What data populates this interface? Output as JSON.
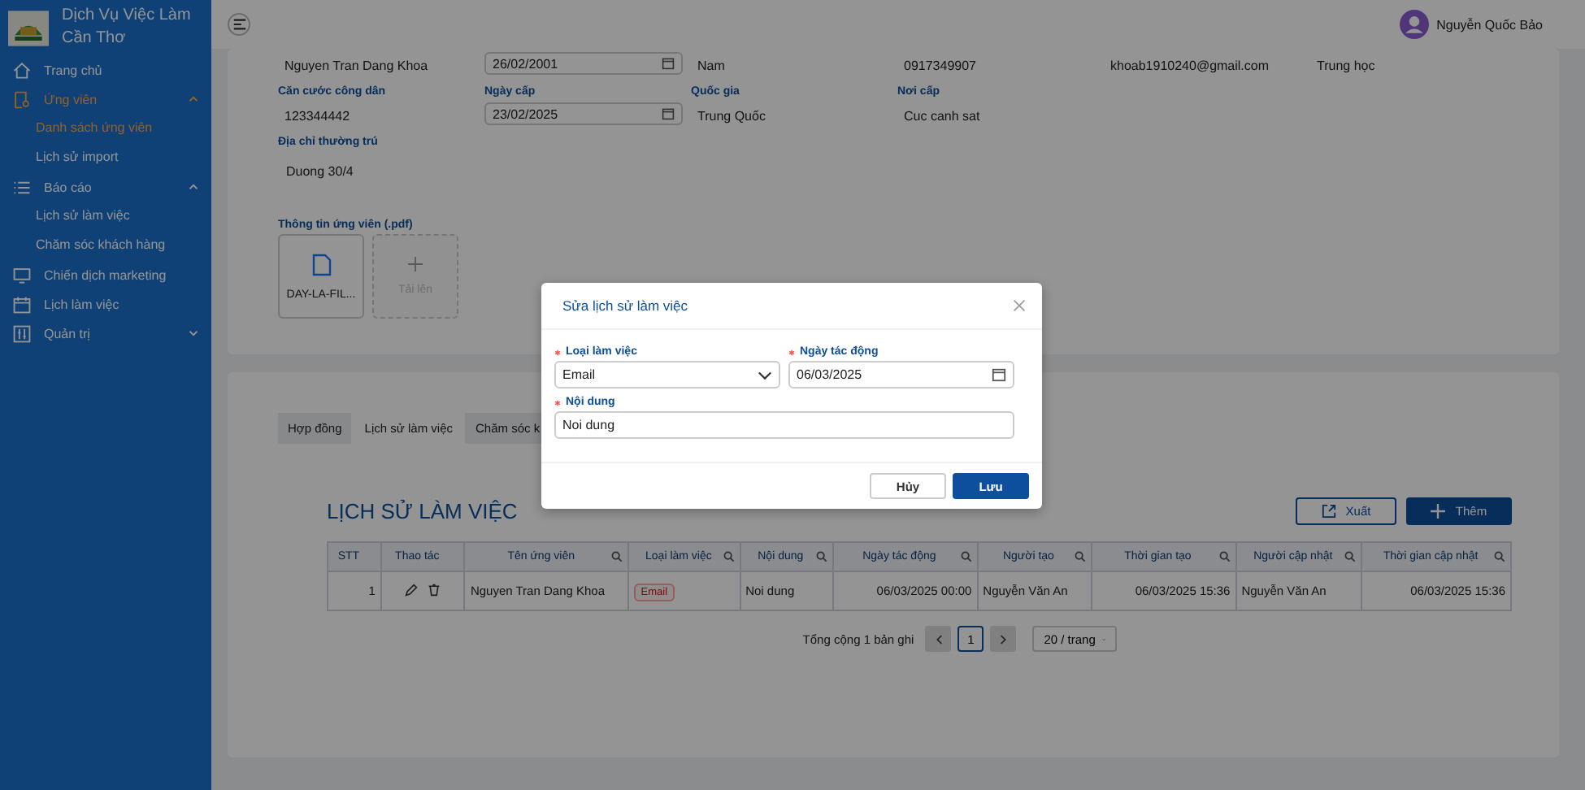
{
  "sidebar": {
    "brand": "Dịch Vụ Việc Làm Cần Thơ",
    "items": [
      {
        "label": "Trang chủ",
        "selected": false
      },
      {
        "label": "Ứng viên",
        "selected": true,
        "expanded": true,
        "children": [
          {
            "label": "Danh sách ứng viên",
            "selected": true
          },
          {
            "label": "Lịch sử import",
            "selected": false
          }
        ]
      },
      {
        "label": "Báo cáo",
        "selected": false,
        "expanded": true,
        "children": [
          {
            "label": "Lịch sử làm việc",
            "selected": false
          },
          {
            "label": "Chăm sóc khách hàng",
            "selected": false
          }
        ]
      },
      {
        "label": "Chiến dịch marketing",
        "selected": false
      },
      {
        "label": "Lịch làm việc",
        "selected": false
      },
      {
        "label": "Quản trị",
        "selected": false,
        "expanded": false
      }
    ]
  },
  "header": {
    "user": "Nguyễn Quốc Bảo"
  },
  "profile": {
    "rows": [
      [
        {
          "value": "Nguyen Tran Dang Khoa",
          "kind": "text"
        },
        {
          "value": "26/02/2001",
          "kind": "date"
        },
        {
          "value": "Nam",
          "kind": "text"
        },
        {
          "value": "0917349907",
          "kind": "text"
        },
        {
          "value": "khoab1910240@gmail.com",
          "kind": "text"
        },
        {
          "value": "Trung học",
          "kind": "text"
        }
      ],
      [
        {
          "label": "Căn cước công dân",
          "value": "123344442",
          "kind": "text"
        },
        {
          "label": "Ngày cấp",
          "value": "23/02/2025",
          "kind": "date"
        },
        {
          "label": "Quốc gia",
          "value": "Trung Quốc",
          "kind": "text"
        },
        {
          "label": "Nơi cấp",
          "value": "Cuc canh sat",
          "kind": "text"
        }
      ],
      [
        {
          "label": "Địa chỉ thường trú",
          "value": "Duong 30/4",
          "kind": "textarea"
        }
      ]
    ],
    "attachments": {
      "label": "Thông tin ứng viên (.pdf)",
      "files": [
        {
          "name": "DAY-LA-FIL..."
        }
      ],
      "upload": "Tải lên"
    }
  },
  "tabs": [
    {
      "label": "Hợp đồng",
      "selected": false
    },
    {
      "label": "Lịch sử làm việc",
      "selected": true
    },
    {
      "label": "Chăm sóc k",
      "selected": false
    }
  ],
  "history": {
    "title": "LỊCH SỬ LÀM VIỆC",
    "buttons": [
      {
        "label": "Xuất",
        "kind": "export"
      },
      {
        "label": "Thêm",
        "kind": "add"
      }
    ],
    "columns": [
      {
        "label": "STT",
        "searchable": false
      },
      {
        "label": "Thao tác",
        "searchable": false
      },
      {
        "label": "Tên ứng viên",
        "searchable": true
      },
      {
        "label": "Loại làm việc",
        "searchable": true
      },
      {
        "label": "Nội dung",
        "searchable": true
      },
      {
        "label": "Ngày tác động",
        "searchable": true
      },
      {
        "label": "Người tạo",
        "searchable": true
      },
      {
        "label": "Thời gian tạo",
        "searchable": true
      },
      {
        "label": "Người cập nhật",
        "searchable": true
      },
      {
        "label": "Thời gian cập nhật",
        "searchable": true
      }
    ],
    "rows": [
      {
        "stt": "1",
        "name": "Nguyen Tran Dang Khoa",
        "type": "Email",
        "content": "Noi dung",
        "action_date": "06/03/2025 00:00",
        "created_by": "Nguyễn Văn An",
        "created_at": "06/03/2025 15:36",
        "updated_by": "Nguyễn Văn An",
        "updated_at": "06/03/2025 15:36"
      }
    ],
    "pagination": {
      "total": "Tổng cộng 1 bản ghi",
      "pages": [
        {
          "label": "1",
          "selected": true
        }
      ],
      "page_size": "20 / trang"
    }
  },
  "modal": {
    "title": "Sửa lịch sử làm việc",
    "fields": [
      {
        "label": "Loại làm việc",
        "required": true,
        "kind": "select",
        "value": "Email"
      },
      {
        "label": "Ngày tác động",
        "required": true,
        "kind": "date",
        "value": "06/03/2025"
      },
      {
        "label": "Nội dung",
        "required": true,
        "kind": "text",
        "value": "Noi dung"
      }
    ],
    "buttons": [
      {
        "label": "Hủy",
        "kind": "default"
      },
      {
        "label": "Lưu",
        "kind": "primary"
      }
    ]
  }
}
